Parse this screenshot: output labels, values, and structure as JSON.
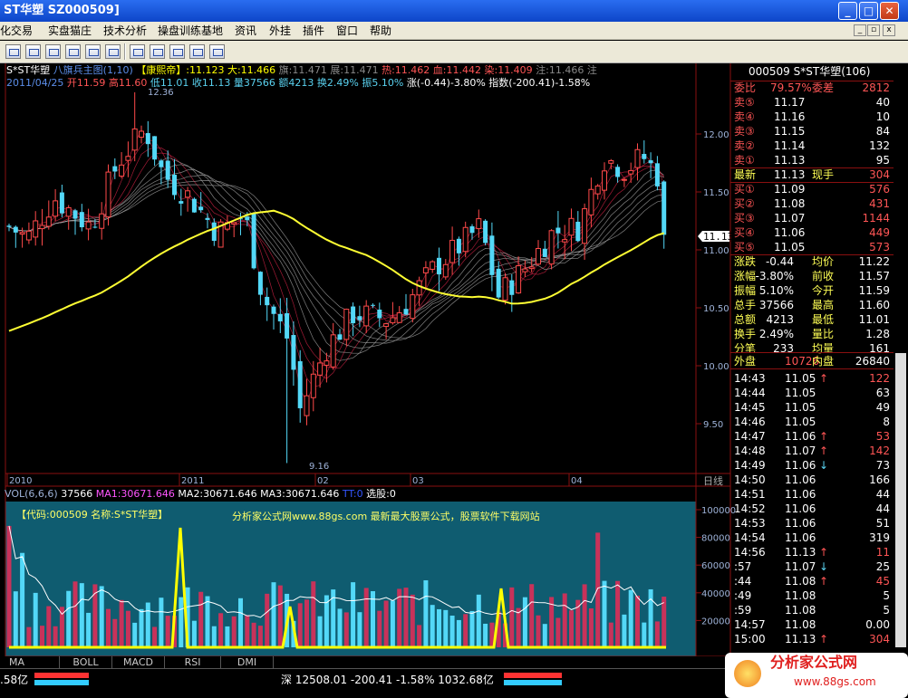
{
  "window": {
    "title": "ST华塑  SZ000509]",
    "minimize": "_",
    "maximize": "□",
    "close": "✕",
    "mdi_min": "_",
    "mdi_restore": "▫",
    "mdi_close": "x"
  },
  "menu": [
    "化交易",
    "实盘猫庄",
    "技术分析",
    "操盘训练基地",
    "资讯",
    "外挂",
    "插件",
    "窗口",
    "帮助"
  ],
  "toolbar_icons": [
    "book-icon",
    "book-icon",
    "people-icon",
    "people-icon",
    "pen-icon",
    "wrench-icon",
    "grid-icon",
    "grid-icon",
    "grid-icon",
    "grid-icon",
    "chart-icon"
  ],
  "main_chart": {
    "info1": {
      "name": "S*ST华塑",
      "indicator": "八旗兵主图(1,10)",
      "kx": "【康熙帝】",
      "kx_val": ":11.123",
      "da": "大:11.466",
      "qi": "旗:11.471",
      "zhan": "展:11.471",
      "re": "热:11.462",
      "xue": "血:11.442",
      "ran": "染:11.409",
      "zhu": "注:11.466",
      "zhu2": "注"
    },
    "info2": {
      "date": "2011/04/25",
      "open": "开11.59",
      "high": "高11.60",
      "low": "低11.01",
      "close": "收11.13",
      "vol": "量37566",
      "amt": "额4213",
      "turn": "换2.49%",
      "amp": "振5.10%",
      "chg": "涨(-0.44)-3.80%",
      "idx": "指数(-200.41)-1.58%"
    },
    "high_mark": "12.36",
    "low_mark": "9.16",
    "price_tag": "11.13",
    "date_labels": [
      "2010",
      "2011",
      "02",
      "03",
      "04"
    ],
    "period": "日线"
  },
  "vol_panel": {
    "label": "VOL(6,6,6)",
    "v": "37566",
    "ma1": "MA1:30671.646",
    "ma2": "MA2:30671.646",
    "ma3": "MA3:30671.646",
    "tt": "TT:0",
    "xg": "选股:0",
    "code_text": "【代码:000509 名称:S*ST华塑】",
    "watermark": "分析家公式网www.88gs.com 最新最大股票公式，股票软件下载网站"
  },
  "chart_data": {
    "type": "candlestick",
    "yaxis_price": [
      "12.00",
      "11.50",
      "11.00",
      "10.50",
      "10.00",
      "9.50"
    ],
    "yaxis_volume": [
      "100000",
      "80000",
      "60000",
      "40000",
      "20000"
    ],
    "last": {
      "date": "2011/04/25",
      "open": 11.59,
      "high": 11.6,
      "low": 11.01,
      "close": 11.13,
      "volume": 37566
    },
    "high": 12.36,
    "low": 9.16
  },
  "tabs": [
    "MA",
    "BOLL",
    "MACD",
    "RSI",
    "DMI"
  ],
  "quote": {
    "header": "000509 S*ST华塑(106)",
    "wb_label": "委比",
    "wb": "79.57%",
    "wc_label": "委差",
    "wc": "2812",
    "sells": [
      {
        "l": "卖⑤",
        "p": "11.17",
        "v": "40"
      },
      {
        "l": "卖④",
        "p": "11.16",
        "v": "10"
      },
      {
        "l": "卖③",
        "p": "11.15",
        "v": "84"
      },
      {
        "l": "卖②",
        "p": "11.14",
        "v": "132"
      },
      {
        "l": "卖①",
        "p": "11.13",
        "v": "95"
      }
    ],
    "latest_label": "最新",
    "latest": "11.13",
    "now_label": "现手",
    "now": "304",
    "buys": [
      {
        "l": "买①",
        "p": "11.09",
        "v": "576"
      },
      {
        "l": "买②",
        "p": "11.08",
        "v": "431"
      },
      {
        "l": "买③",
        "p": "11.07",
        "v": "1144"
      },
      {
        "l": "买④",
        "p": "11.06",
        "v": "449"
      },
      {
        "l": "买⑤",
        "p": "11.05",
        "v": "573"
      }
    ],
    "stats": [
      {
        "a": "涨跌",
        "b": "-0.44",
        "c": "均价",
        "d": "11.22"
      },
      {
        "a": "涨幅",
        "b": "-3.80%",
        "c": "前收",
        "d": "11.57"
      },
      {
        "a": "振幅",
        "b": "5.10%",
        "c": "今开",
        "d": "11.59"
      },
      {
        "a": "总手",
        "b": "37566",
        "c": "最高",
        "d": "11.60"
      },
      {
        "a": "总额",
        "b": "4213",
        "c": "最低",
        "d": "11.01"
      },
      {
        "a": "换手",
        "b": "2.49%",
        "c": "量比",
        "d": "1.28"
      },
      {
        "a": "分笔",
        "b": "233",
        "c": "均量",
        "d": "161"
      }
    ],
    "outer_label": "外盘",
    "outer": "10726",
    "inner_label": "内盘",
    "inner": "26840",
    "ticks": [
      {
        "t": "14:43",
        "p": "11.05",
        "a": "↑",
        "v": "122"
      },
      {
        "t": "14:44",
        "p": "11.05",
        "a": "",
        "v": "63"
      },
      {
        "t": "14:45",
        "p": "11.05",
        "a": "",
        "v": "49"
      },
      {
        "t": "14:46",
        "p": "11.05",
        "a": "",
        "v": "8"
      },
      {
        "t": "14:47",
        "p": "11.06",
        "a": "↑",
        "v": "53"
      },
      {
        "t": "14:48",
        "p": "11.07",
        "a": "↑",
        "v": "142"
      },
      {
        "t": "14:49",
        "p": "11.06",
        "a": "↓",
        "v": "73"
      },
      {
        "t": "14:50",
        "p": "11.06",
        "a": "",
        "v": "166"
      },
      {
        "t": "14:51",
        "p": "11.06",
        "a": "",
        "v": "44"
      },
      {
        "t": "14:52",
        "p": "11.06",
        "a": "",
        "v": "44"
      },
      {
        "t": "14:53",
        "p": "11.06",
        "a": "",
        "v": "51"
      },
      {
        "t": "14:54",
        "p": "11.06",
        "a": "",
        "v": "319"
      },
      {
        "t": "14:56",
        "p": "11.13",
        "a": "↑",
        "v": "11"
      },
      {
        "t": ":57",
        "p": "11.07",
        "a": "↓",
        "v": "25"
      },
      {
        "t": ":44",
        "p": "11.08",
        "a": "↑",
        "v": "45"
      },
      {
        "t": ":49",
        "p": "11.08",
        "a": "",
        "v": "5"
      },
      {
        "t": ":59",
        "p": "11.08",
        "a": "",
        "v": "5"
      },
      {
        "t": "14:57",
        "p": "11.08",
        "a": "",
        "v": "0.00"
      },
      {
        "t": "15:00",
        "p": "11.13",
        "a": "↑",
        "v": "304"
      }
    ]
  },
  "status": {
    "left": ".58亿",
    "mid": "深 12508.01 -200.41 -1.58% 1032.68亿",
    "logo": "分析家公式网",
    "url": "www.88gs.com"
  }
}
